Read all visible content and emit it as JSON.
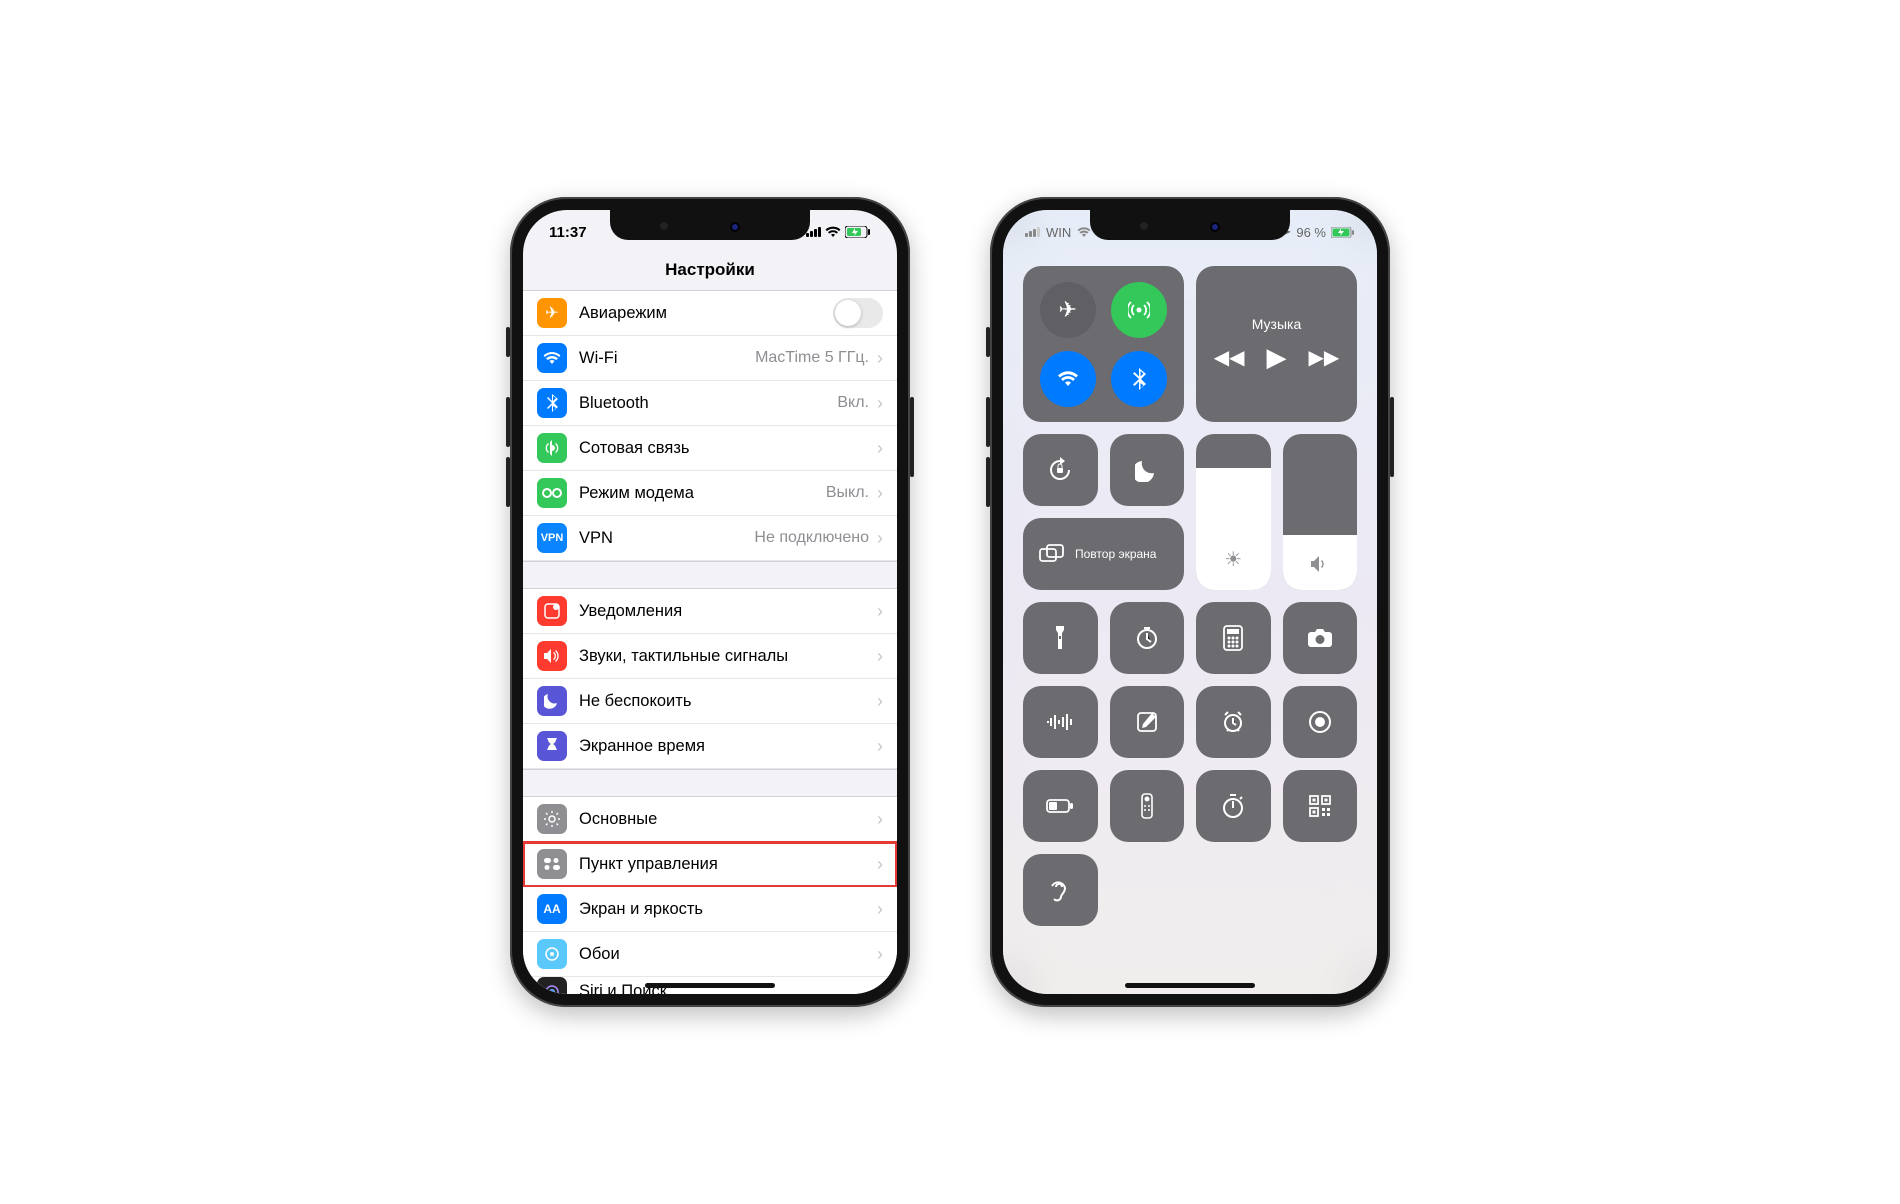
{
  "settings": {
    "status": {
      "time": "11:37"
    },
    "title": "Настройки",
    "rows": {
      "airplane": {
        "label": "Авиарежим"
      },
      "wifi": {
        "label": "Wi-Fi",
        "value": "MacTime 5 ГГц."
      },
      "bluetooth": {
        "label": "Bluetooth",
        "value": "Вкл."
      },
      "cellular": {
        "label": "Сотовая связь"
      },
      "hotspot": {
        "label": "Режим модема",
        "value": "Выкл."
      },
      "vpn": {
        "label": "VPN",
        "value": "Не подключено"
      },
      "notifications": {
        "label": "Уведомления"
      },
      "sounds": {
        "label": "Звуки, тактильные сигналы"
      },
      "dnd": {
        "label": "Не беспокоить"
      },
      "screentime": {
        "label": "Экранное время"
      },
      "general": {
        "label": "Основные"
      },
      "controlcenter": {
        "label": "Пункт управления"
      },
      "display": {
        "label": "Экран и яркость"
      },
      "wallpaper": {
        "label": "Обои"
      },
      "siri": {
        "label": "Siri и Поиск"
      }
    }
  },
  "cc": {
    "status": {
      "carrier": "WIN",
      "battery": "96 %"
    },
    "music_label": "Музыка",
    "screen_repeat": "Повтор экрана",
    "brightness_pct": 78,
    "volume_pct": 35
  }
}
